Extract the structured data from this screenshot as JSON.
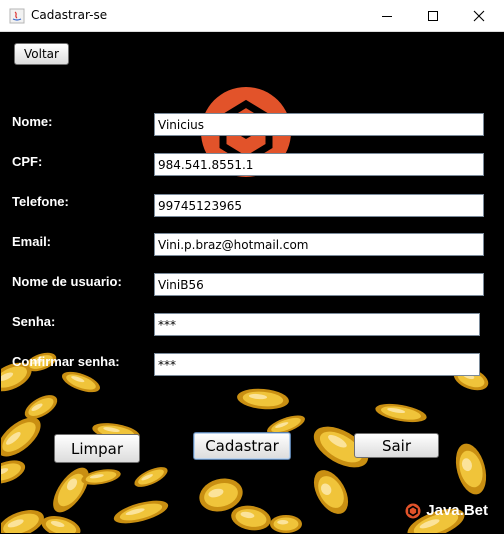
{
  "window": {
    "title": "Cadastrar-se",
    "controls": {
      "minimize": "minimize",
      "maximize": "maximize",
      "close": "close"
    }
  },
  "toolbar": {
    "back_label": "Voltar"
  },
  "form": {
    "fields": [
      {
        "key": "nome",
        "label": "Nome:",
        "value": "Vinicius"
      },
      {
        "key": "cpf",
        "label": "CPF:",
        "value": "984.541.8551.1"
      },
      {
        "key": "telefone",
        "label": "Telefone:",
        "value": "99745123965"
      },
      {
        "key": "email",
        "label": "Email:",
        "value": "Vini.p.braz@hotmail.com"
      },
      {
        "key": "usuario",
        "label": "Nome de usuario:",
        "value": "ViniB56"
      },
      {
        "key": "senha",
        "label": "Senha:",
        "value": "***"
      },
      {
        "key": "confirmar",
        "label": "Confirmar senha:",
        "value": "***"
      }
    ]
  },
  "actions": {
    "clear_label": "Limpar",
    "register_label": "Cadastrar",
    "exit_label": "Sair"
  },
  "branding": {
    "text": "Java.Bet",
    "accent": "#e2532a"
  },
  "colors": {
    "background": "#000000",
    "coin": "#e0a81c"
  }
}
